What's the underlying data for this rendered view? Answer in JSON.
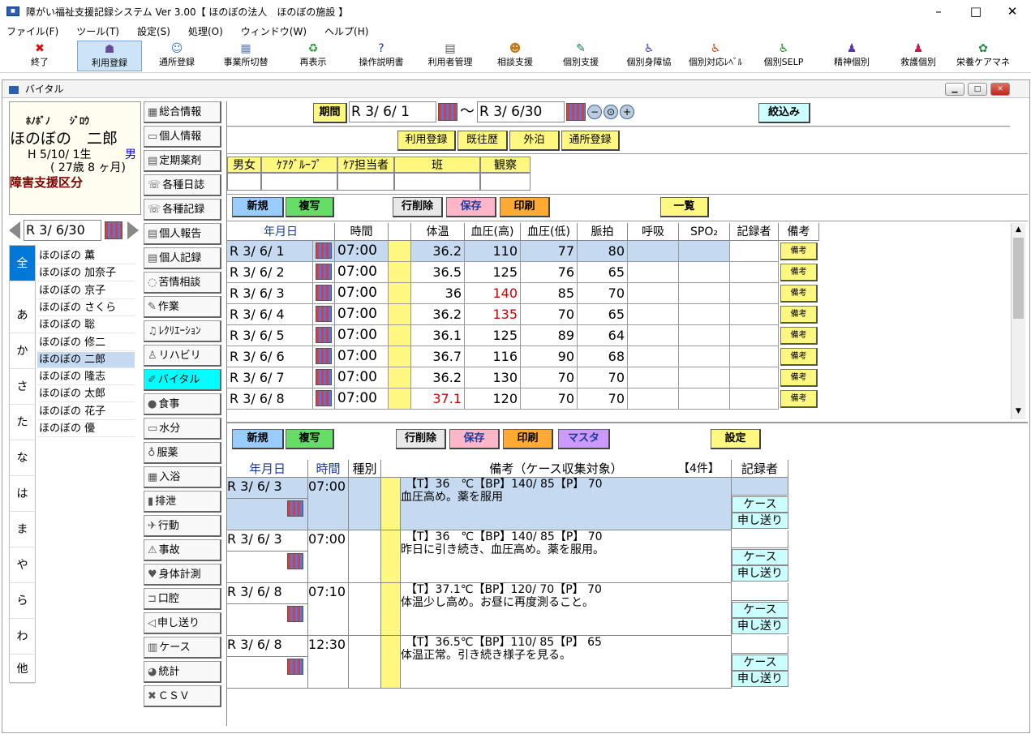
{
  "window": {
    "title": "障がい福祉支援記録システム Ver 3.00【 ほのぼの法人　ほのぼの施設 】",
    "app_icon": "app-icon",
    "min": "–",
    "max": "□",
    "close": "✕"
  },
  "menubar": [
    "ファイル(F)",
    "ツール(T)",
    "設定(S)",
    "処理(O)",
    "ウィンドウ(W)",
    "ヘルプ(H)"
  ],
  "toolbar": [
    {
      "label": "終了",
      "icon": "✖",
      "color": "#d01010"
    },
    {
      "label": "利用登録",
      "icon": "☗",
      "color": "#6a4a9a"
    },
    {
      "label": "通所登録",
      "icon": "☺",
      "color": "#3a7ac0"
    },
    {
      "label": "事業所切替",
      "icon": "▦",
      "color": "#6080c0"
    },
    {
      "label": "再表示",
      "icon": "♻",
      "color": "#2a9a3a"
    },
    {
      "label": "操作説明書",
      "icon": "?",
      "color": "#1a3a9a"
    },
    {
      "label": "利用者管理",
      "icon": "▤",
      "color": "#555"
    },
    {
      "label": "相談支援",
      "icon": "☻",
      "color": "#c07a1a"
    },
    {
      "label": "個別支援",
      "icon": "✎",
      "color": "#1a7a4a"
    },
    {
      "label": "個別身障協",
      "icon": "♿",
      "color": "#4a4ab0"
    },
    {
      "label": "個別対応ﾚﾍﾞﾙ",
      "icon": "♿",
      "color": "#c05020"
    },
    {
      "label": "個別SELP",
      "icon": "♿",
      "color": "#2a8a2a"
    },
    {
      "label": "精神個別",
      "icon": "♟",
      "color": "#5a3aa0"
    },
    {
      "label": "救護個別",
      "icon": "♟",
      "color": "#c02050"
    },
    {
      "label": "栄養ケアマネ",
      "icon": "✿",
      "color": "#2a8a4a"
    }
  ],
  "child": {
    "title": "バイタル",
    "icon": "vital-window-icon",
    "min": "▁",
    "max": "□",
    "close": "✕"
  },
  "profile": {
    "kana": "ﾎﾉﾎﾞﾉ　　ｼﾞﾛｳ",
    "name": "ほのぼの　二郎",
    "birth": "H 5/10/ 1生",
    "sex": "男",
    "age": "( 27歳 8 ヶ月)",
    "kubun": "障害支援区分"
  },
  "list_date": "R  3/  6/30",
  "kana_tabs": [
    "全",
    "あ",
    "か",
    "さ",
    "た",
    "な",
    "は",
    "ま",
    "や",
    "ら",
    "わ",
    "他"
  ],
  "names": [
    "ほのぼの  薫",
    "ほのぼの  加奈子",
    "ほのぼの  京子",
    "ほのぼの  さくら",
    "ほのぼの  聡",
    "ほのぼの  修二",
    "ほのぼの  二郎",
    "ほのぼの  隆志",
    "ほのぼの  太郎",
    "ほのぼの  花子",
    "ほのぼの  優"
  ],
  "selected_name_index": 6,
  "side_menu": [
    {
      "label": "総合情報",
      "icon": "▦"
    },
    {
      "label": "個人情報",
      "icon": "▭"
    },
    {
      "label": "定期薬剤",
      "icon": "▤"
    },
    {
      "label": "各種日誌",
      "icon": "☏"
    },
    {
      "label": "各種記録",
      "icon": "☏"
    },
    {
      "label": "個人報告",
      "icon": "▤"
    },
    {
      "label": "個人記録",
      "icon": "▤"
    },
    {
      "label": "苦情相談",
      "icon": "◌"
    },
    {
      "label": "作業",
      "icon": "✎"
    },
    {
      "label": "ﾚｸﾘｴｰｼｮﾝ",
      "icon": "♫"
    },
    {
      "label": "リハビリ",
      "icon": "♙"
    },
    {
      "label": "バイタル",
      "icon": "✐"
    },
    {
      "label": "食事",
      "icon": "●"
    },
    {
      "label": "水分",
      "icon": "▭"
    },
    {
      "label": "服薬",
      "icon": "♁"
    },
    {
      "label": "入浴",
      "icon": "▦"
    },
    {
      "label": "排泄",
      "icon": "▮"
    },
    {
      "label": "行動",
      "icon": "✈"
    },
    {
      "label": "事故",
      "icon": "⚠"
    },
    {
      "label": "身体計測",
      "icon": "♥"
    },
    {
      "label": "口腔",
      "icon": "⊐"
    },
    {
      "label": "申し送り",
      "icon": "◁"
    },
    {
      "label": "ケース",
      "icon": "▥"
    },
    {
      "label": "統計",
      "icon": "◕"
    },
    {
      "label": "ＣＳＶ",
      "icon": "✖"
    }
  ],
  "selected_menu_index": 11,
  "filter": {
    "period_label": "期間",
    "date_from": "R  3/  6/  1",
    "tilde": "～",
    "date_to": "R  3/  6/30",
    "zoom_out": "−",
    "zoom_fit": "⊙",
    "zoom_in": "+",
    "narrow": "絞込み"
  },
  "links": [
    "利用登録",
    "既往歴",
    "外泊",
    "通所登録"
  ],
  "group_headers": [
    "男女",
    "ｹｱｸﾞﾙｰﾌﾟ",
    "ｹｱ担当者",
    "班",
    "観察"
  ],
  "vital_buttons": {
    "new": "新規",
    "copy": "複写",
    "del": "行削除",
    "save": "保存",
    "print": "印刷",
    "list": "一覧"
  },
  "vital_headers": [
    "年月日",
    "時間",
    "",
    "体温",
    "血圧(高)",
    "血圧(低)",
    "脈拍",
    "呼吸",
    "SPO₂",
    "記録者",
    "備考"
  ],
  "vital_rows": [
    {
      "date": "R  3/  6/  1",
      "time": "07:00",
      "temp": "36.2",
      "bph": "110",
      "bpl": "77",
      "pulse": "80",
      "temp_red": false,
      "bph_red": false
    },
    {
      "date": "R  3/  6/  2",
      "time": "07:00",
      "temp": "36.5",
      "bph": "125",
      "bpl": "76",
      "pulse": "65",
      "temp_red": false,
      "bph_red": false
    },
    {
      "date": "R  3/  6/  3",
      "time": "07:00",
      "temp": "36",
      "bph": "140",
      "bpl": "85",
      "pulse": "70",
      "temp_red": false,
      "bph_red": true
    },
    {
      "date": "R  3/  6/  4",
      "time": "07:00",
      "temp": "36.2",
      "bph": "135",
      "bpl": "70",
      "pulse": "65",
      "temp_red": false,
      "bph_red": true
    },
    {
      "date": "R  3/  6/  5",
      "time": "07:00",
      "temp": "36.1",
      "bph": "125",
      "bpl": "89",
      "pulse": "64",
      "temp_red": false,
      "bph_red": false
    },
    {
      "date": "R  3/  6/  6",
      "time": "07:00",
      "temp": "36.7",
      "bph": "116",
      "bpl": "90",
      "pulse": "68",
      "temp_red": false,
      "bph_red": false
    },
    {
      "date": "R  3/  6/  7",
      "time": "07:00",
      "temp": "36.2",
      "bph": "130",
      "bpl": "70",
      "pulse": "70",
      "temp_red": false,
      "bph_red": false
    },
    {
      "date": "R  3/  6/  8",
      "time": "07:00",
      "temp": "37.1",
      "bph": "120",
      "bpl": "70",
      "pulse": "70",
      "temp_red": true,
      "bph_red": false
    }
  ],
  "bikou_label": "備考",
  "case_buttons": {
    "new": "新規",
    "copy": "複写",
    "del": "行削除",
    "save": "保存",
    "print": "印刷",
    "master": "マスタ",
    "settings": "設定"
  },
  "case_headers": {
    "date": "年月日",
    "time": "時間",
    "type": "種別",
    "note": "備考（ケース収集対象）",
    "count": "【4件】",
    "recorder": "記録者"
  },
  "case_rows": [
    {
      "date": "R  3/  6/  3",
      "time": "07:00",
      "line1": "【T】36　℃【BP】140/ 85【P】 70",
      "line2": "血圧高め。薬を服用",
      "tag1": "ケース",
      "tag2": "申し送り"
    },
    {
      "date": "R  3/  6/  3",
      "time": "07:00",
      "line1": "【T】36　℃【BP】140/ 85【P】 70",
      "line2": "昨日に引き続き、血圧高め。薬を服用。",
      "tag1": "ケース",
      "tag2": "申し送り"
    },
    {
      "date": "R  3/  6/  8",
      "time": "07:10",
      "line1": "【T】37.1℃【BP】120/ 70【P】 70",
      "line2": "体温少し高め。お昼に再度測ること。",
      "tag1": "ケース",
      "tag2": "申し送り"
    },
    {
      "date": "R  3/  6/  8",
      "time": "12:30",
      "line1": "【T】36.5℃【BP】110/ 85【P】 65",
      "line2": "体温正常。引き続き様子を見る。",
      "tag1": "ケース",
      "tag2": "申し送り"
    }
  ],
  "colors": {
    "selected_row": "#c5d9f1",
    "yellow": "#fff880",
    "cyan": "#00ffff",
    "green_btn": "#66dd66",
    "blue_btn": "#99ccff",
    "pink_btn": "#ffb6c8",
    "orange_btn": "#ffaa33",
    "purple_btn": "#cc99ff"
  }
}
